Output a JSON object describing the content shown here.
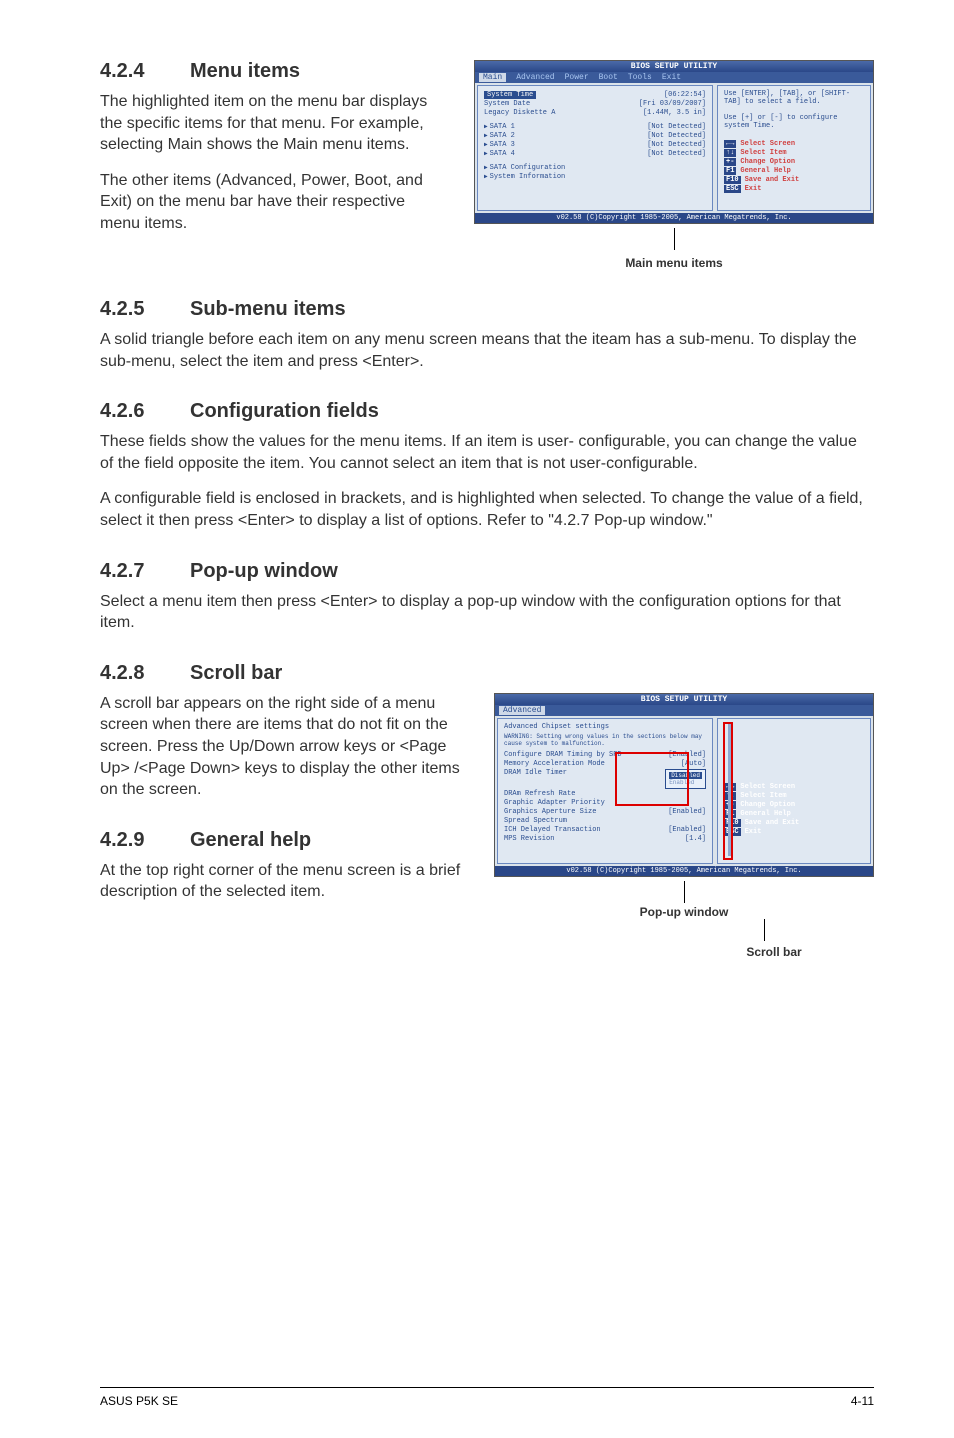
{
  "sections": {
    "s424": {
      "num": "4.2.4",
      "title": "Menu items",
      "p1": "The highlighted item on the menu bar displays the specific items for that menu. For example, selecting Main shows the Main menu items.",
      "p2": "The other items (Advanced, Power, Boot, and Exit) on the menu bar have their respective menu items."
    },
    "s425": {
      "num": "4.2.5",
      "title": "Sub-menu items",
      "p1": "A solid triangle before each item on any menu screen means that the iteam has a sub-menu. To display the sub-menu, select the item and press <Enter>."
    },
    "s426": {
      "num": "4.2.6",
      "title": "Configuration fields",
      "p1": "These fields show the values for the menu items. If an item is user- configurable, you can change the value of the field opposite the item. You cannot select an item that is not user-configurable.",
      "p2": "A configurable field is enclosed in brackets, and is highlighted when selected. To change the value of a field, select it then press <Enter> to display a list of options. Refer to \"4.2.7 Pop-up window.\""
    },
    "s427": {
      "num": "4.2.7",
      "title": "Pop-up window",
      "p1": "Select a menu item then press <Enter> to display a pop-up window with the configuration options for that item."
    },
    "s428": {
      "num": "4.2.8",
      "title": "Scroll bar",
      "p1": "A scroll bar appears on the right side of a menu screen when there are items that do not fit on the screen. Press the Up/Down arrow keys or <Page Up> /<Page Down> keys to display the other items on the screen."
    },
    "s429": {
      "num": "4.2.9",
      "title": "General help",
      "p1": "At the top right corner of the menu screen is a brief description of the selected item."
    }
  },
  "labels": {
    "main_menu_items": "Main menu items",
    "pop_up_window": "Pop-up window",
    "scroll_bar": "Scroll bar"
  },
  "bios1": {
    "title": "BIOS SETUP UTILITY",
    "tabs": [
      "Main",
      "Advanced",
      "Power",
      "Boot",
      "Tools",
      "Exit"
    ],
    "rows": [
      {
        "k": "System Time",
        "v": "[06:22:54]"
      },
      {
        "k": "System Date",
        "v": "[Fri 03/09/2007]"
      },
      {
        "k": "Legacy Diskette A",
        "v": "[1.44M, 3.5 in]"
      },
      {
        "k": "SATA 1",
        "v": "[Not Detected]",
        "tri": true
      },
      {
        "k": "SATA 2",
        "v": "[Not Detected]",
        "tri": true
      },
      {
        "k": "SATA 3",
        "v": "[Not Detected]",
        "tri": true
      },
      {
        "k": "SATA 4",
        "v": "[Not Detected]",
        "tri": true
      },
      {
        "k": "SATA Configuration",
        "v": "",
        "tri": true
      },
      {
        "k": "System Information",
        "v": "",
        "tri": true
      }
    ],
    "help_top": "Use [ENTER], [TAB], or [SHIFT-TAB] to select a field.",
    "help_mid": "Use [+] or [-] to configure system Time.",
    "nav": [
      {
        "k": "←→",
        "t": "Select Screen"
      },
      {
        "k": "↑↓",
        "t": "Select Item"
      },
      {
        "k": "+-",
        "t": "Change Option"
      },
      {
        "k": "F1",
        "t": "General Help"
      },
      {
        "k": "F10",
        "t": "Save and Exit"
      },
      {
        "k": "ESC",
        "t": "Exit"
      }
    ],
    "foot": "v02.58 (C)Copyright 1985-2005, American Megatrends, Inc."
  },
  "bios2": {
    "title": "BIOS SETUP UTILITY",
    "tab": "Advanced",
    "header": "Advanced Chipset settings",
    "warn": "WARNING: Setting wrong values in the sections below may cause system to malfunction.",
    "rows": [
      {
        "k": "Configure DRAM Timing by SPD",
        "v": "[Enabled]"
      },
      {
        "k": "Memory Acceleration Mode",
        "v": "[Auto]"
      },
      {
        "k": "DRAM Idle Timer",
        "v": ""
      },
      {
        "k": "DRAm Refresh Rate",
        "v": ""
      },
      {
        "k": "Graphic Adapter Priority",
        "v": ""
      },
      {
        "k": "Graphics Aperture Size",
        "v": "[Enabled]"
      },
      {
        "k": "Spread Spectrum",
        "v": ""
      },
      {
        "k": "ICH Delayed Transaction",
        "v": "[Enabled]"
      },
      {
        "k": "MPS Revision",
        "v": "[1.4]"
      }
    ],
    "popup": {
      "options": [
        "Disabled",
        "Enabled"
      ],
      "hl": 0
    },
    "nav": [
      {
        "k": "←→",
        "t": "Select Screen"
      },
      {
        "k": "↑↓",
        "t": "Select Item"
      },
      {
        "k": "+-",
        "t": "Change Option"
      },
      {
        "k": "F1",
        "t": "General Help"
      },
      {
        "k": "F10",
        "t": "Save and Exit"
      },
      {
        "k": "ESC",
        "t": "Exit"
      }
    ],
    "foot": "v02.58 (C)Copyright 1985-2005, American Megatrends, Inc."
  },
  "footer": {
    "left": "ASUS P5K SE",
    "right": "4-11"
  }
}
